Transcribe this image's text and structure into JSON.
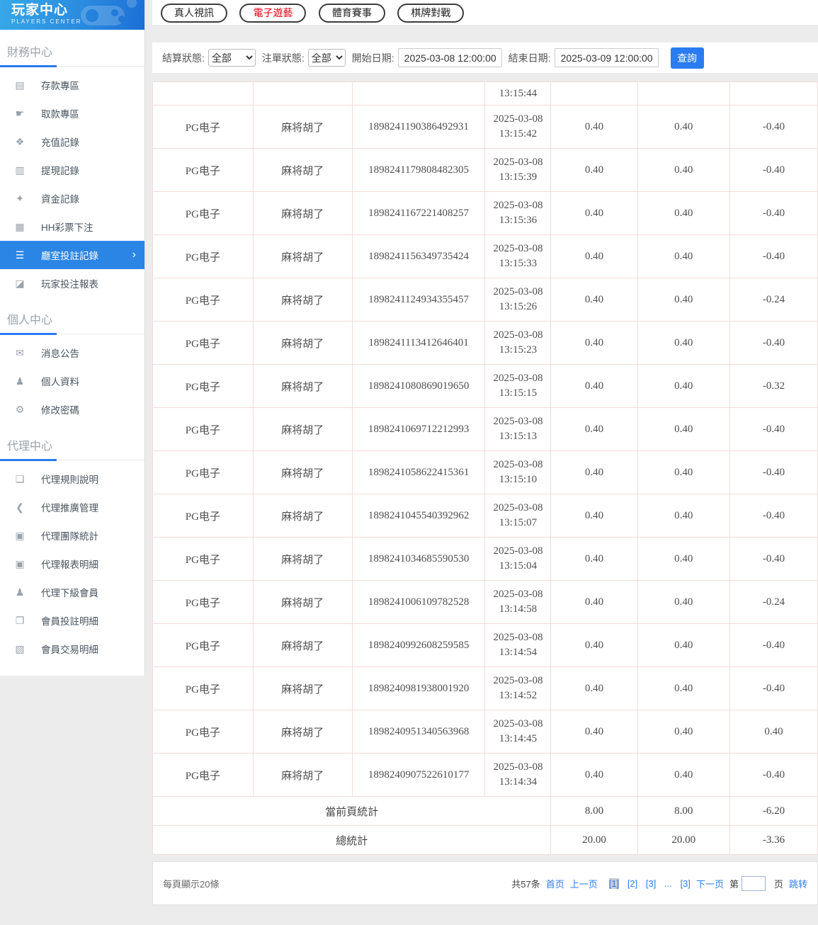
{
  "sidebar": {
    "header": {
      "title": "玩家中心",
      "subtitle": "PLAYERS CENTER"
    },
    "sections": [
      {
        "title": "財務中心",
        "items": [
          {
            "icon": "deposit-card-icon",
            "label": "存款專區"
          },
          {
            "icon": "withdraw-hand-icon",
            "label": "取款專區"
          },
          {
            "icon": "recharge-moneybag-icon",
            "label": "充值記錄"
          },
          {
            "icon": "cashout-wallet-icon",
            "label": "提現記錄"
          },
          {
            "icon": "funds-moneybag-icon",
            "label": "資金記錄"
          },
          {
            "icon": "lottery-list-icon",
            "label": "HH彩票下注"
          },
          {
            "icon": "bet-records-list-icon",
            "label": "廳室投註記錄",
            "active": true
          },
          {
            "icon": "report-chart-icon",
            "label": "玩家投注報表"
          }
        ]
      },
      {
        "title": "個人中心",
        "items": [
          {
            "icon": "bell-icon",
            "label": "消息公告"
          },
          {
            "icon": "user-icon",
            "label": "個人資料"
          },
          {
            "icon": "gear-icon",
            "label": "修改密碼"
          }
        ]
      },
      {
        "title": "代理中心",
        "items": [
          {
            "icon": "document-icon",
            "label": "代理規則說明"
          },
          {
            "icon": "share-icon",
            "label": "代理推廣管理"
          },
          {
            "icon": "news-report-icon",
            "label": "代理團隊統計"
          },
          {
            "icon": "news-report-icon",
            "label": "代理報表明細"
          },
          {
            "icon": "users-icon",
            "label": "代理下級會員"
          },
          {
            "icon": "clipboard-icon",
            "label": "會員投註明細"
          },
          {
            "icon": "transaction-list-icon",
            "label": "會員交易明細"
          }
        ]
      }
    ]
  },
  "tabs": [
    {
      "label": "真人視訊",
      "active": false
    },
    {
      "label": "電子遊藝",
      "active": true
    },
    {
      "label": "體育賽事",
      "active": false
    },
    {
      "label": "棋牌對戰",
      "active": false
    }
  ],
  "filters": {
    "settle_label": "結算狀態:",
    "settle_value": "全部",
    "order_label": "注單狀態:",
    "order_value": "全部",
    "start_label": "開始日期:",
    "start_value": "2025-03-08 12:00:00",
    "end_label": "結束日期:",
    "end_value": "2025-03-09 12:00:00",
    "search_label": "查詢"
  },
  "table": {
    "partial_row": {
      "time": "13:15:44"
    },
    "rows": [
      {
        "provider": "PG电子",
        "game": "麻将胡了",
        "order": "1898241190386492931",
        "date": "2025-03-08",
        "time": "13:15:42",
        "bet": "0.40",
        "valid": "0.40",
        "profit": "-0.40"
      },
      {
        "provider": "PG电子",
        "game": "麻将胡了",
        "order": "1898241179808482305",
        "date": "2025-03-08",
        "time": "13:15:39",
        "bet": "0.40",
        "valid": "0.40",
        "profit": "-0.40"
      },
      {
        "provider": "PG电子",
        "game": "麻将胡了",
        "order": "1898241167221408257",
        "date": "2025-03-08",
        "time": "13:15:36",
        "bet": "0.40",
        "valid": "0.40",
        "profit": "-0.40"
      },
      {
        "provider": "PG电子",
        "game": "麻将胡了",
        "order": "1898241156349735424",
        "date": "2025-03-08",
        "time": "13:15:33",
        "bet": "0.40",
        "valid": "0.40",
        "profit": "-0.40"
      },
      {
        "provider": "PG电子",
        "game": "麻将胡了",
        "order": "1898241124934355457",
        "date": "2025-03-08",
        "time": "13:15:26",
        "bet": "0.40",
        "valid": "0.40",
        "profit": "-0.24"
      },
      {
        "provider": "PG电子",
        "game": "麻将胡了",
        "order": "1898241113412646401",
        "date": "2025-03-08",
        "time": "13:15:23",
        "bet": "0.40",
        "valid": "0.40",
        "profit": "-0.40"
      },
      {
        "provider": "PG电子",
        "game": "麻将胡了",
        "order": "1898241080869019650",
        "date": "2025-03-08",
        "time": "13:15:15",
        "bet": "0.40",
        "valid": "0.40",
        "profit": "-0.32"
      },
      {
        "provider": "PG电子",
        "game": "麻将胡了",
        "order": "1898241069712212993",
        "date": "2025-03-08",
        "time": "13:15:13",
        "bet": "0.40",
        "valid": "0.40",
        "profit": "-0.40"
      },
      {
        "provider": "PG电子",
        "game": "麻将胡了",
        "order": "1898241058622415361",
        "date": "2025-03-08",
        "time": "13:15:10",
        "bet": "0.40",
        "valid": "0.40",
        "profit": "-0.40"
      },
      {
        "provider": "PG电子",
        "game": "麻将胡了",
        "order": "1898241045540392962",
        "date": "2025-03-08",
        "time": "13:15:07",
        "bet": "0.40",
        "valid": "0.40",
        "profit": "-0.40"
      },
      {
        "provider": "PG电子",
        "game": "麻将胡了",
        "order": "1898241034685590530",
        "date": "2025-03-08",
        "time": "13:15:04",
        "bet": "0.40",
        "valid": "0.40",
        "profit": "-0.40"
      },
      {
        "provider": "PG电子",
        "game": "麻将胡了",
        "order": "1898241006109782528",
        "date": "2025-03-08",
        "time": "13:14:58",
        "bet": "0.40",
        "valid": "0.40",
        "profit": "-0.24"
      },
      {
        "provider": "PG电子",
        "game": "麻将胡了",
        "order": "1898240992608259585",
        "date": "2025-03-08",
        "time": "13:14:54",
        "bet": "0.40",
        "valid": "0.40",
        "profit": "-0.40"
      },
      {
        "provider": "PG电子",
        "game": "麻将胡了",
        "order": "1898240981938001920",
        "date": "2025-03-08",
        "time": "13:14:52",
        "bet": "0.40",
        "valid": "0.40",
        "profit": "-0.40"
      },
      {
        "provider": "PG电子",
        "game": "麻将胡了",
        "order": "1898240951340563968",
        "date": "2025-03-08",
        "time": "13:14:45",
        "bet": "0.40",
        "valid": "0.40",
        "profit": "0.40"
      },
      {
        "provider": "PG电子",
        "game": "麻将胡了",
        "order": "1898240907522610177",
        "date": "2025-03-08",
        "time": "13:14:34",
        "bet": "0.40",
        "valid": "0.40",
        "profit": "-0.40"
      }
    ],
    "page_total": {
      "label": "當前頁統計",
      "bet": "8.00",
      "valid": "8.00",
      "profit": "-6.20"
    },
    "grand_total": {
      "label": "總統計",
      "bet": "20.00",
      "valid": "20.00",
      "profit": "-3.36"
    }
  },
  "pagination": {
    "per_page": "每頁顯示20條",
    "total": "共57条",
    "first": "首页",
    "prev": "上一页",
    "pages": [
      {
        "label": "[1]",
        "active": true
      },
      {
        "label": "[2]",
        "active": false
      },
      {
        "label": "[3]",
        "active": false
      },
      {
        "label": "...",
        "active": false
      },
      {
        "label": "[3]",
        "active": false
      }
    ],
    "next": "下一页",
    "jump_prefix": "第",
    "jump_suffix": "页",
    "jump_action": "跳转"
  },
  "colors": {
    "accent_blue": "#2b7cf0",
    "sidebar_active_bg": "#2b85e4",
    "tab_active_red": "#e60012",
    "link_blue": "#2f7cf0",
    "table_border_pink": "#f2dcda",
    "header_gradient_start": "#38a8e8",
    "header_gradient_end": "#1c6fd6"
  }
}
